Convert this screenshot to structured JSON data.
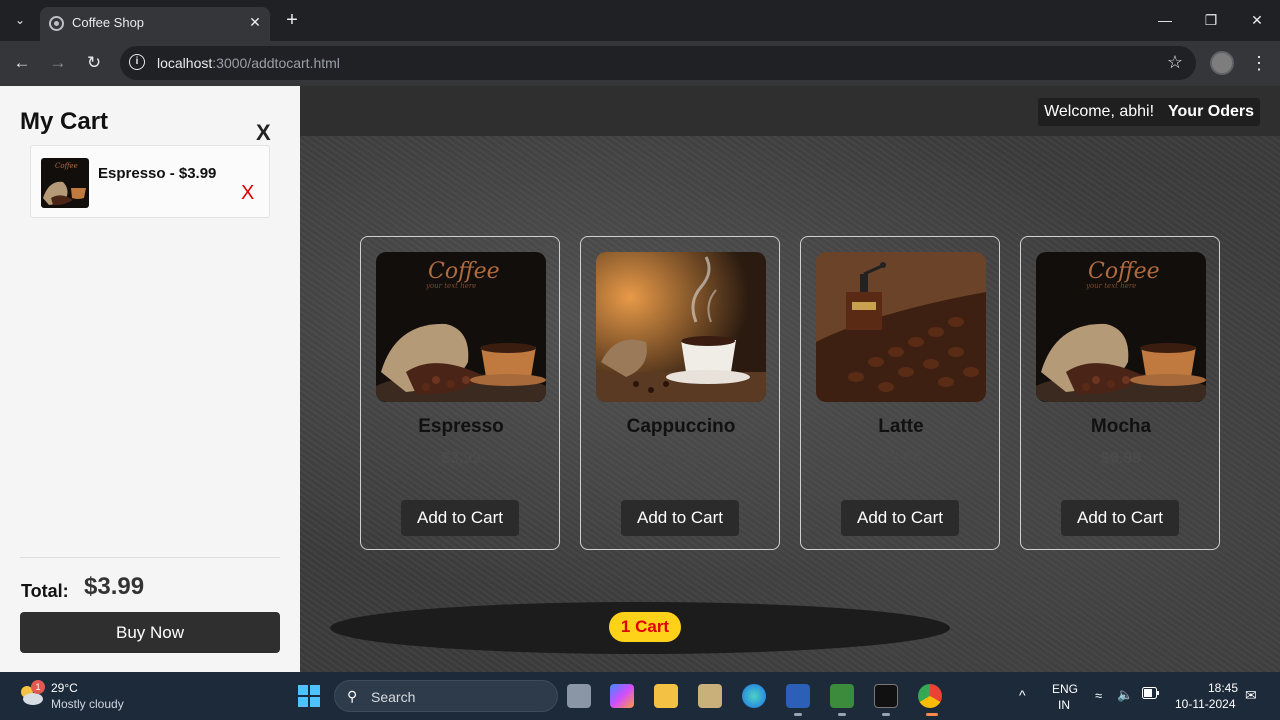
{
  "browser": {
    "tab_title": "Coffee Shop",
    "url_host": "localhost",
    "url_path": ":3000/addtocart.html"
  },
  "header": {
    "welcome": "Welcome, abhi!",
    "orders_link": "Your Oders"
  },
  "products": [
    {
      "name": "Espresso",
      "price": "$3.99",
      "button": "Add to Cart",
      "image": "coffee-sack-cup-image"
    },
    {
      "name": "Cappuccino",
      "price": "$4.99",
      "button": "Add to Cart",
      "image": "steaming-coffee-cup-image"
    },
    {
      "name": "Latte",
      "price": "$5.99",
      "button": "Add to Cart",
      "image": "coffee-grinder-beans-image"
    },
    {
      "name": "Mocha",
      "price": "$6.99",
      "button": "Add to Cart",
      "image": "coffee-sack-cup-image"
    }
  ],
  "cart": {
    "title": "My Cart",
    "close_label": "X",
    "items": [
      {
        "name": "Espresso - $3.99",
        "remove_label": "X"
      }
    ],
    "total_label": "Total:",
    "total_value": "$3.99",
    "buy_button": "Buy Now",
    "floating_badge": "1 Cart"
  },
  "taskbar": {
    "weather_temp": "29°C",
    "weather_desc": "Mostly cloudy",
    "weather_badge": "1",
    "search_placeholder": "Search",
    "language": "ENG",
    "region": "IN",
    "time": "18:45",
    "date": "10-11-2024"
  },
  "colors": {
    "cart_badge_bg": "#ffd21a",
    "cart_badge_text": "#e00000",
    "remove_x": "#e10000"
  }
}
